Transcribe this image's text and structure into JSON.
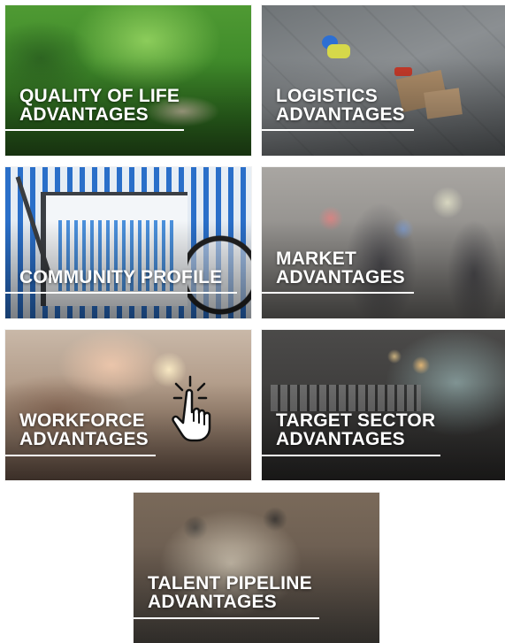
{
  "tiles": [
    {
      "id": "quality-of-life",
      "lines": [
        "QUALITY OF LIFE",
        "ADVANTAGES"
      ]
    },
    {
      "id": "logistics",
      "lines": [
        "LOGISTICS",
        "ADVANTAGES"
      ]
    },
    {
      "id": "community-profile",
      "lines": [
        "COMMUNITY PROFILE"
      ]
    },
    {
      "id": "market",
      "lines": [
        "MARKET",
        "ADVANTAGES"
      ]
    },
    {
      "id": "workforce",
      "lines": [
        "WORKFORCE",
        "ADVANTAGES"
      ]
    },
    {
      "id": "target-sector",
      "lines": [
        "TARGET SECTOR",
        "ADVANTAGES"
      ]
    },
    {
      "id": "talent-pipeline",
      "lines": [
        "TALENT PIPELINE",
        "ADVANTAGES"
      ]
    }
  ],
  "colors": {
    "label_text": "#ffffff",
    "rule": "#ffffff"
  },
  "icons": {
    "cursor": "hand-pointer-icon"
  }
}
